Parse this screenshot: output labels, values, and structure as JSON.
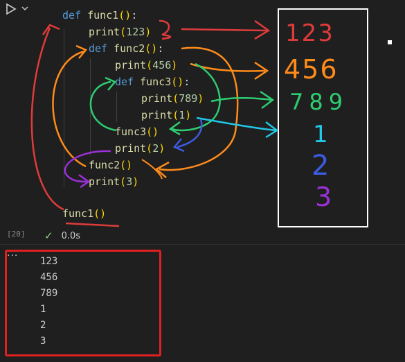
{
  "gutter": {
    "execution_count": "[20]",
    "run_icon": "play-icon",
    "dropdown_icon": "chevron-down-icon"
  },
  "code": {
    "lines": [
      {
        "parts": [
          [
            "kw",
            "def "
          ],
          [
            "fn",
            "func1"
          ],
          [
            "paren",
            "()"
          ],
          [
            "plain",
            ":"
          ]
        ]
      },
      {
        "parts": [
          [
            "fn",
            "print"
          ],
          [
            "paren",
            "("
          ],
          [
            "num",
            "123"
          ],
          [
            "paren",
            ")"
          ]
        ]
      },
      {
        "parts": [
          [
            "kw",
            "def "
          ],
          [
            "fn",
            "func2"
          ],
          [
            "paren",
            "()"
          ],
          [
            "plain",
            ":"
          ]
        ]
      },
      {
        "parts": [
          [
            "fn",
            "print"
          ],
          [
            "paren",
            "("
          ],
          [
            "num",
            "456"
          ],
          [
            "paren",
            ")"
          ]
        ]
      },
      {
        "parts": [
          [
            "kw",
            "def "
          ],
          [
            "fn",
            "func3"
          ],
          [
            "paren",
            "()"
          ],
          [
            "plain",
            ":"
          ]
        ]
      },
      {
        "parts": [
          [
            "fn",
            "print"
          ],
          [
            "paren",
            "("
          ],
          [
            "num",
            "789"
          ],
          [
            "paren",
            ")"
          ]
        ]
      },
      {
        "parts": [
          [
            "fn",
            "print"
          ],
          [
            "paren",
            "("
          ],
          [
            "num",
            "1"
          ],
          [
            "paren",
            ")"
          ]
        ]
      },
      {
        "parts": [
          [
            "fn",
            "func3"
          ],
          [
            "paren",
            "()"
          ]
        ]
      },
      {
        "parts": [
          [
            "fn",
            "print"
          ],
          [
            "paren",
            "("
          ],
          [
            "num",
            "2"
          ],
          [
            "paren",
            ")"
          ]
        ]
      },
      {
        "parts": [
          [
            "fn",
            "func2"
          ],
          [
            "paren",
            "()"
          ]
        ]
      },
      {
        "parts": [
          [
            "fn",
            "print"
          ],
          [
            "paren",
            "("
          ],
          [
            "num",
            "3"
          ],
          [
            "paren",
            ")"
          ]
        ]
      },
      {
        "parts": []
      },
      {
        "parts": [
          [
            "fn",
            "func1"
          ],
          [
            "paren",
            "()"
          ]
        ]
      }
    ]
  },
  "status": {
    "check_icon": "check-icon",
    "duration": "0.0s"
  },
  "output": {
    "menu_label": "···",
    "lines": [
      "123",
      "456",
      "789",
      "1",
      "2",
      "3"
    ]
  },
  "annotations": {
    "handwritten_results": [
      "123",
      "456",
      "789",
      "1",
      "2",
      "3"
    ],
    "colors": {
      "red": "#e03b3b",
      "orange": "#ff8c1a",
      "green": "#2ecc71",
      "cyan": "#21c7e6",
      "blue": "#3c5ce0",
      "purple": "#9b30d9",
      "output_box": "#e02020",
      "result_box": "#ffffff"
    }
  }
}
